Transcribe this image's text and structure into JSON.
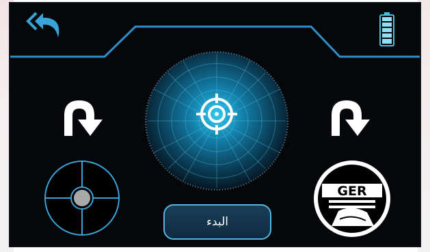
{
  "start_button": {
    "label": "البدء"
  },
  "logo": {
    "text": "GER"
  },
  "battery": {
    "bars_filled": 5,
    "bars_total": 5
  },
  "colors": {
    "accent": "#3aa4d8",
    "frame_line": "#2f8fc8",
    "background": "#05070b",
    "radar_glow": "#2bc6f0",
    "button_fill": "#163651",
    "target": "#ffffff",
    "joystick_knob": "#a8a8a8"
  },
  "icons": {
    "back": "back-arrow-icon",
    "battery": "battery-icon",
    "left_turn": "turn-right-arrow-icon",
    "right_turn": "turn-right-arrow-icon",
    "target": "crosshair-target-icon",
    "joystick": "joystick-icon",
    "logo": "ger-logo-icon"
  }
}
